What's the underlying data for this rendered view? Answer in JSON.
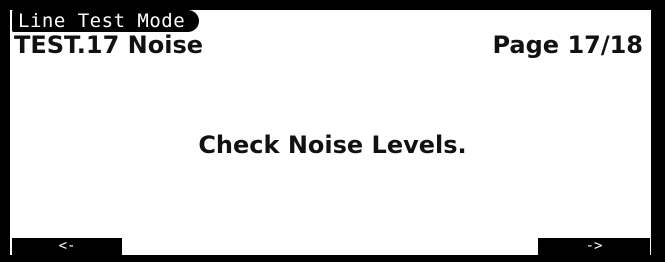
{
  "mode_label": "Line Test Mode",
  "title": "TEST.17 Noise",
  "page_indicator": "Page 17/18",
  "message": "Check Noise Levels.",
  "softkeys": {
    "left_label": "<-",
    "right_label": "->"
  },
  "colors": {
    "background": "#ffffff",
    "foreground": "#000000"
  }
}
